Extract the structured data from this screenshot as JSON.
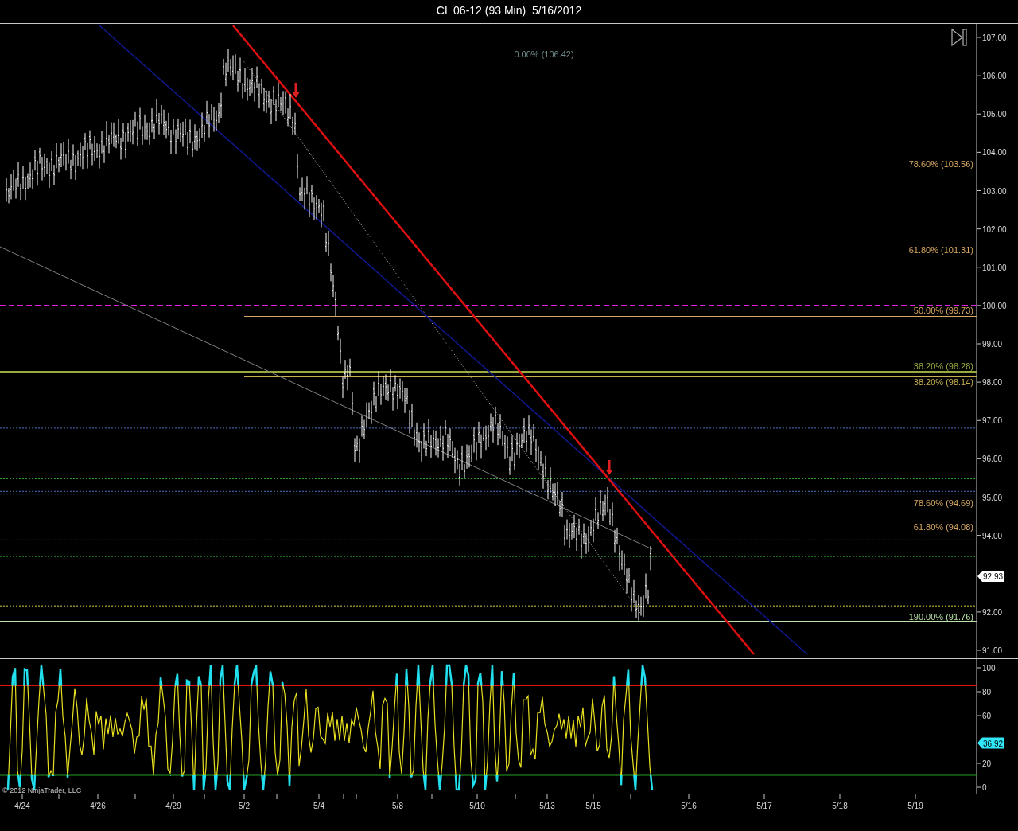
{
  "title": "CL 06-12 (93 Min)  5/16/2012",
  "price_panel": {
    "axis_labels": [
      "107.00",
      "106.00",
      "105.00",
      "104.00",
      "103.00",
      "102.00",
      "101.00",
      "100.00",
      "99.00",
      "98.00",
      "97.00",
      "96.00",
      "95.00",
      "94.00",
      "92.00",
      "91.00"
    ],
    "last_price": "92.93",
    "fib_levels": [
      {
        "label": "0.00% (106.42)",
        "color": "#6f8a8a"
      },
      {
        "label": "78.60% (103.56)",
        "color": "#d8a860"
      },
      {
        "label": "61.80% (101.31)",
        "color": "#d8a860"
      },
      {
        "label": "50.00% (99.73)",
        "color": "#d8a860"
      },
      {
        "label": "38.20% (98.28)",
        "color": "#9aa840"
      },
      {
        "label": "38.20% (98.14)",
        "color": "#c8b050"
      },
      {
        "label": "78.60% (94.69)",
        "color": "#d8a860"
      },
      {
        "label": "61.80% (94.08)",
        "color": "#d8a860"
      },
      {
        "label": "190.00% (91.76)",
        "color": "#b8e0a8"
      }
    ]
  },
  "indicator_panel": {
    "axis_labels": [
      "100",
      "80",
      "60",
      "20",
      "0"
    ],
    "current_value": "36.92",
    "copyright": "© 2012 NinjaTrader, LLC"
  },
  "date_axis": {
    "labels": [
      "4/24",
      "4/26",
      "4/29",
      "5/2",
      "5/4",
      "5/8",
      "5/10",
      "5/13",
      "5/15",
      "5/16",
      "5/17",
      "5/18",
      "5/19"
    ]
  }
}
